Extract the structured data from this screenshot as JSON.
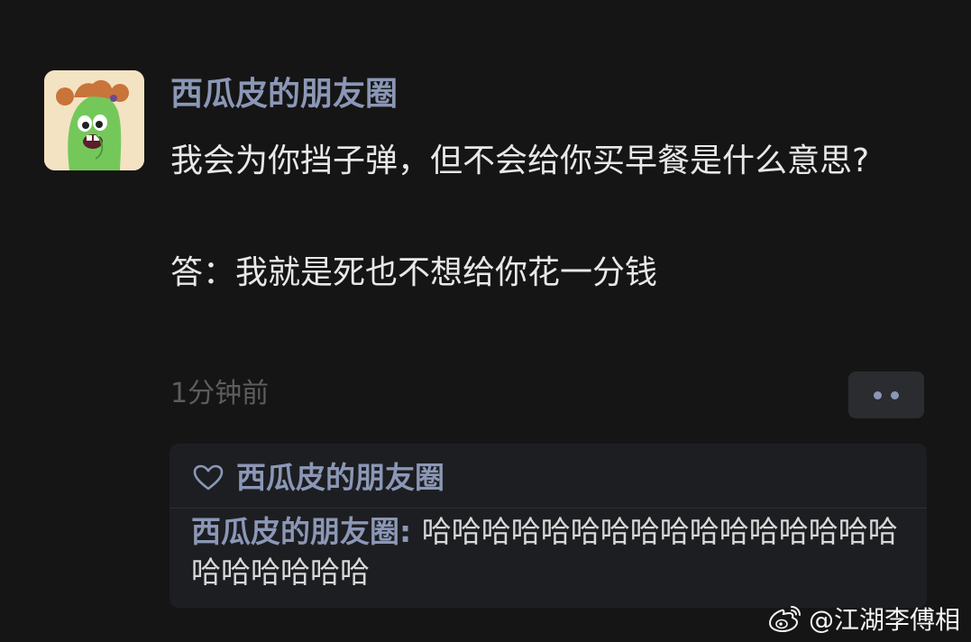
{
  "post": {
    "author": "西瓜皮的朋友圈",
    "line1": "我会为你挡子弹，但不会给你买早餐是什么意思?",
    "line2": "答：我就是死也不想给你花一分钱",
    "time": "1分钟前"
  },
  "likes": {
    "name": "西瓜皮的朋友圈"
  },
  "comment": {
    "author": "西瓜皮的朋友圈",
    "separator": ": ",
    "text": "哈哈哈哈哈哈哈哈哈哈哈哈哈哈哈哈哈哈哈哈哈哈"
  },
  "watermark": {
    "text": "@江湖李傅相"
  },
  "icons": {
    "avatar": "cartoon-avatar-icon",
    "more": "more-dots-icon",
    "like": "heart-outline-icon",
    "brand": "weibo-icon"
  },
  "colors": {
    "background": "#151515",
    "name_link": "#8b97b6",
    "text": "#e8e8e8",
    "timestamp": "#5d5d5d",
    "panel": "#1d1e21"
  }
}
